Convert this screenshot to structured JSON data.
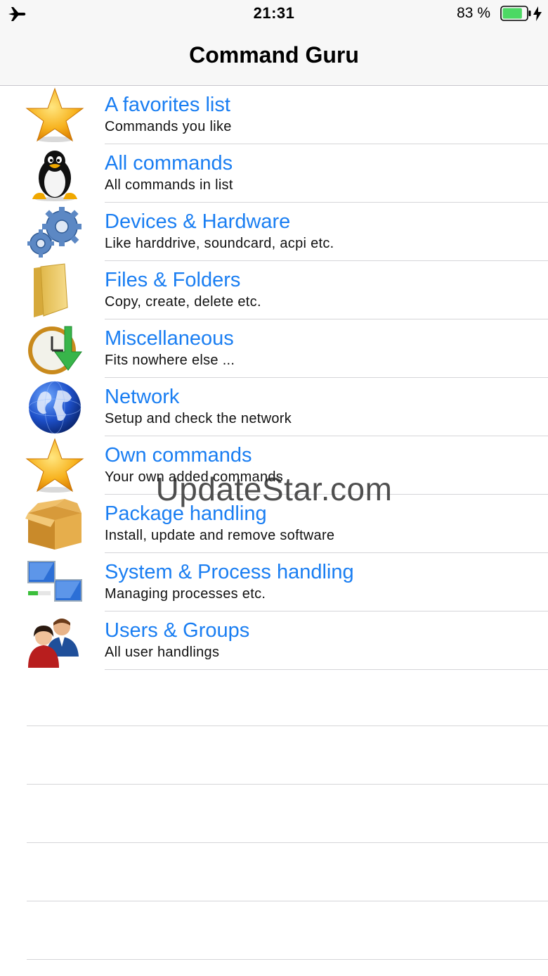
{
  "status_bar": {
    "time": "21:31",
    "battery_percent": "83 %",
    "battery_level": 0.83,
    "icons": [
      "airplane-icon",
      "battery-icon",
      "charging-bolt-icon"
    ]
  },
  "nav": {
    "title": "Command Guru"
  },
  "categories": [
    {
      "label": "A favorites list",
      "subtitle": "Commands you like",
      "icon": "star-icon"
    },
    {
      "label": "All commands",
      "subtitle": "All commands in list",
      "icon": "penguin-icon"
    },
    {
      "label": "Devices & Hardware",
      "subtitle": "Like harddrive, soundcard, acpi etc.",
      "icon": "gears-icon"
    },
    {
      "label": "Files & Folders",
      "subtitle": "Copy, create, delete etc.",
      "icon": "folder-icon"
    },
    {
      "label": "Miscellaneous",
      "subtitle": "Fits nowhere else ...",
      "icon": "clock-icon"
    },
    {
      "label": "Network",
      "subtitle": "Setup and check the network",
      "icon": "globe-icon"
    },
    {
      "label": "Own commands",
      "subtitle": "Your own added commands",
      "icon": "star-icon"
    },
    {
      "label": "Package handling",
      "subtitle": "Install, update and remove software",
      "icon": "package-box-icon"
    },
    {
      "label": "System & Process handling",
      "subtitle": "Managing processes etc.",
      "icon": "monitors-icon"
    },
    {
      "label": "Users & Groups",
      "subtitle": "All user handlings",
      "icon": "users-icon"
    }
  ],
  "watermark": "UpdateStar.com",
  "colors": {
    "accent": "#1a7ef2",
    "bar_background": "#f7f7f7",
    "battery_fill": "#4cd964"
  }
}
